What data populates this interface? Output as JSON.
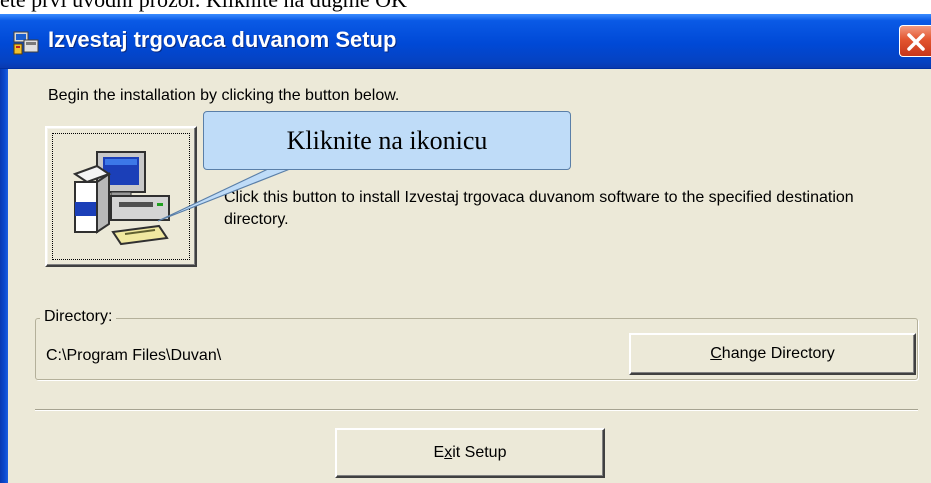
{
  "caption": "ete prvi uvodni prozor. Kliknite na dugme OK",
  "window": {
    "title": "Izvestaj trgovaca duvanom Setup",
    "title_icon": "computer-setup-icon",
    "close_icon": "close-icon"
  },
  "intro_text": "Begin the installation by clicking the button below.",
  "install": {
    "icon": "install-computer-icon",
    "description": "Click this button to install Izvestaj trgovaca duvanom software to the specified destination directory."
  },
  "callout": {
    "text": "Kliknite na ikonicu"
  },
  "directory": {
    "label": "Directory:",
    "path": "C:\\Program Files\\Duvan\\",
    "change_button": {
      "mnemonic": "C",
      "rest": "hange Directory"
    }
  },
  "exit_button": {
    "before": "E",
    "mnemonic": "x",
    "after": "it Setup"
  },
  "colors": {
    "titlebar": "#0049d6",
    "window_bg": "#ece9d8",
    "close_button": "#e3552f",
    "callout_bg": "#bfdcf8"
  }
}
